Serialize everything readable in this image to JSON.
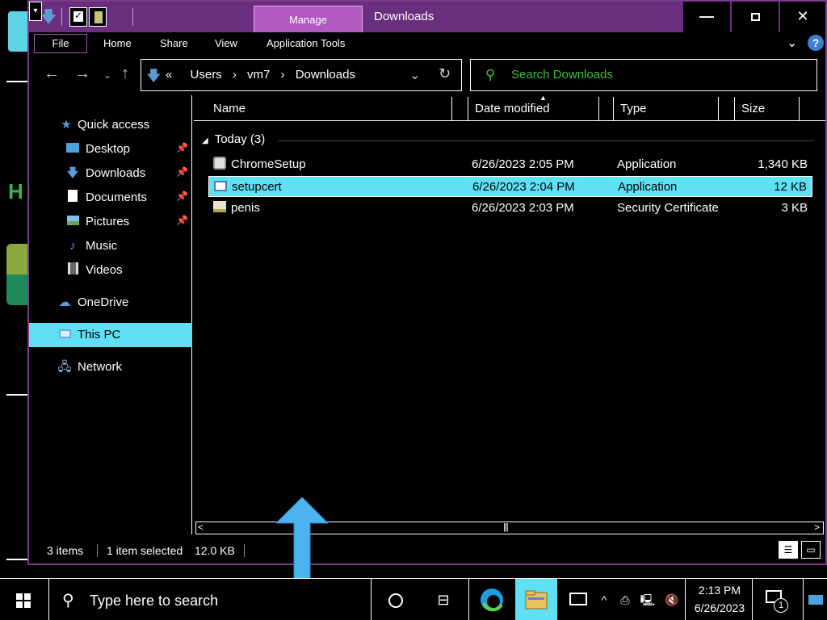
{
  "window": {
    "manage_tab": "Manage",
    "title": "Downloads",
    "min_glyph": "—",
    "close_glyph": "✕"
  },
  "ribbon": {
    "tabs": [
      "File",
      "Home",
      "Share",
      "View",
      "Application Tools"
    ]
  },
  "address": {
    "prefix": "«",
    "crumbs": [
      "Users",
      "vm7",
      "Downloads"
    ]
  },
  "search": {
    "placeholder": "Search Downloads"
  },
  "nav": {
    "items": [
      {
        "label": "Quick access",
        "icon": "star-icon"
      },
      {
        "label": "Desktop",
        "icon": "desktop-icon",
        "pinned": true
      },
      {
        "label": "Downloads",
        "icon": "download-icon",
        "pinned": true
      },
      {
        "label": "Documents",
        "icon": "document-icon",
        "pinned": true
      },
      {
        "label": "Pictures",
        "icon": "picture-icon",
        "pinned": true
      },
      {
        "label": "Music",
        "icon": "music-icon"
      },
      {
        "label": "Videos",
        "icon": "video-icon"
      },
      {
        "label": "OneDrive",
        "icon": "cloud-icon"
      },
      {
        "label": "This PC",
        "icon": "computer-icon",
        "selected": true
      },
      {
        "label": "Network",
        "icon": "network-icon"
      }
    ]
  },
  "columns": {
    "name": "Name",
    "date": "Date modified",
    "type": "Type",
    "size": "Size"
  },
  "group": {
    "label": "Today (3)"
  },
  "files": [
    {
      "name": "ChromeSetup",
      "date": "6/26/2023 2:05 PM",
      "type": "Application",
      "size": "1,340 KB",
      "icon": "installer-icon",
      "selected": false
    },
    {
      "name": "setupcert",
      "date": "6/26/2023 2:04 PM",
      "type": "Application",
      "size": "12 KB",
      "icon": "application-icon",
      "selected": true
    },
    {
      "name": "penis",
      "date": "6/26/2023 2:03 PM",
      "type": "Security Certificate",
      "size": "3 KB",
      "icon": "certificate-icon",
      "selected": false
    }
  ],
  "status": {
    "count": "3 items",
    "selected": "1 item selected",
    "size": "12.0 KB"
  },
  "taskbar": {
    "search_placeholder": "Type here to search",
    "time": "2:13 PM",
    "date": "6/26/2023",
    "notifications": "1"
  },
  "colors": {
    "titlebar": "#6a2e7e",
    "manage_tab": "#b05ac2",
    "selection": "#5fe0f5",
    "search_text": "#3cbf3c",
    "resize_arrow": "#4db3ef"
  }
}
